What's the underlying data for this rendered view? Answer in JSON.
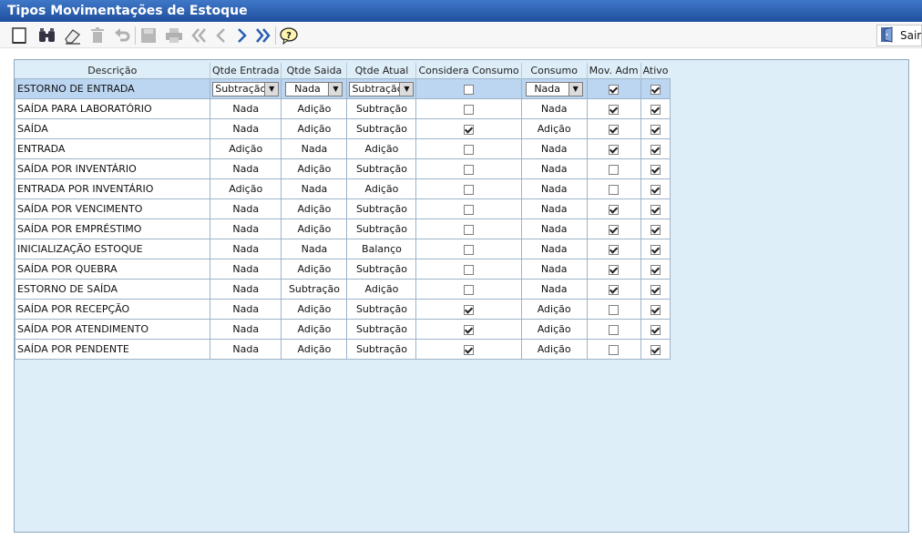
{
  "window": {
    "title": "Tipos Movimentações de Estoque"
  },
  "toolbar": {
    "buttons": [
      "new-icon",
      "search-icon",
      "eraser-icon",
      "delete-icon",
      "undo-icon",
      "save-icon",
      "print-icon",
      "first-icon",
      "prev-icon",
      "next-icon",
      "last-icon",
      "help-icon"
    ],
    "sair_label": "Sair"
  },
  "grid": {
    "columns": [
      "Descrição",
      "Qtde Entrada",
      "Qtde Saida",
      "Qtde Atual",
      "Considera Consumo",
      "Consumo",
      "Mov. Adm",
      "Ativo"
    ],
    "rows": [
      {
        "descricao": "ESTORNO DE ENTRADA",
        "entrada": "Subtração",
        "saida": "Nada",
        "atual": "Subtração",
        "considera": false,
        "consumo": "Nada",
        "mov_adm": true,
        "ativo": true
      },
      {
        "descricao": "SAÍDA PARA LABORATÓRIO",
        "entrada": "Nada",
        "saida": "Adição",
        "atual": "Subtração",
        "considera": false,
        "consumo": "Nada",
        "mov_adm": true,
        "ativo": true
      },
      {
        "descricao": "SAÍDA",
        "entrada": "Nada",
        "saida": "Adição",
        "atual": "Subtração",
        "considera": true,
        "consumo": "Adição",
        "mov_adm": true,
        "ativo": true
      },
      {
        "descricao": "ENTRADA",
        "entrada": "Adição",
        "saida": "Nada",
        "atual": "Adição",
        "considera": false,
        "consumo": "Nada",
        "mov_adm": true,
        "ativo": true
      },
      {
        "descricao": "SAÍDA POR INVENTÁRIO",
        "entrada": "Nada",
        "saida": "Adição",
        "atual": "Subtração",
        "considera": false,
        "consumo": "Nada",
        "mov_adm": false,
        "ativo": true
      },
      {
        "descricao": "ENTRADA POR INVENTÁRIO",
        "entrada": "Adição",
        "saida": "Nada",
        "atual": "Adição",
        "considera": false,
        "consumo": "Nada",
        "mov_adm": false,
        "ativo": true
      },
      {
        "descricao": "SAÍDA POR VENCIMENTO",
        "entrada": "Nada",
        "saida": "Adição",
        "atual": "Subtração",
        "considera": false,
        "consumo": "Nada",
        "mov_adm": true,
        "ativo": true
      },
      {
        "descricao": "SAÍDA POR EMPRÉSTIMO",
        "entrada": "Nada",
        "saida": "Adição",
        "atual": "Subtração",
        "considera": false,
        "consumo": "Nada",
        "mov_adm": true,
        "ativo": true
      },
      {
        "descricao": "INICIALIZAÇÃO ESTOQUE",
        "entrada": "Nada",
        "saida": "Nada",
        "atual": "Balanço",
        "considera": false,
        "consumo": "Nada",
        "mov_adm": true,
        "ativo": true
      },
      {
        "descricao": "SAÍDA POR QUEBRA",
        "entrada": "Nada",
        "saida": "Adição",
        "atual": "Subtração",
        "considera": false,
        "consumo": "Nada",
        "mov_adm": true,
        "ativo": true
      },
      {
        "descricao": "ESTORNO DE SAÍDA",
        "entrada": "Nada",
        "saida": "Subtração",
        "atual": "Adição",
        "considera": false,
        "consumo": "Nada",
        "mov_adm": true,
        "ativo": true
      },
      {
        "descricao": "SAÍDA POR RECEPÇÃO",
        "entrada": "Nada",
        "saida": "Adição",
        "atual": "Subtração",
        "considera": true,
        "consumo": "Adição",
        "mov_adm": false,
        "ativo": true
      },
      {
        "descricao": "SAÍDA POR ATENDIMENTO",
        "entrada": "Nada",
        "saida": "Adição",
        "atual": "Subtração",
        "considera": true,
        "consumo": "Adição",
        "mov_adm": false,
        "ativo": true
      },
      {
        "descricao": "SAÍDA POR PENDENTE",
        "entrada": "Nada",
        "saida": "Adição",
        "atual": "Subtração",
        "considera": true,
        "consumo": "Adição",
        "mov_adm": false,
        "ativo": true
      }
    ],
    "selected_row": 0
  },
  "colors": {
    "title_bar": "#2a5fb0",
    "panel_bg": "#deeef9",
    "selected_row": "#bcd6f2",
    "grid_border": "#9db4c9"
  }
}
